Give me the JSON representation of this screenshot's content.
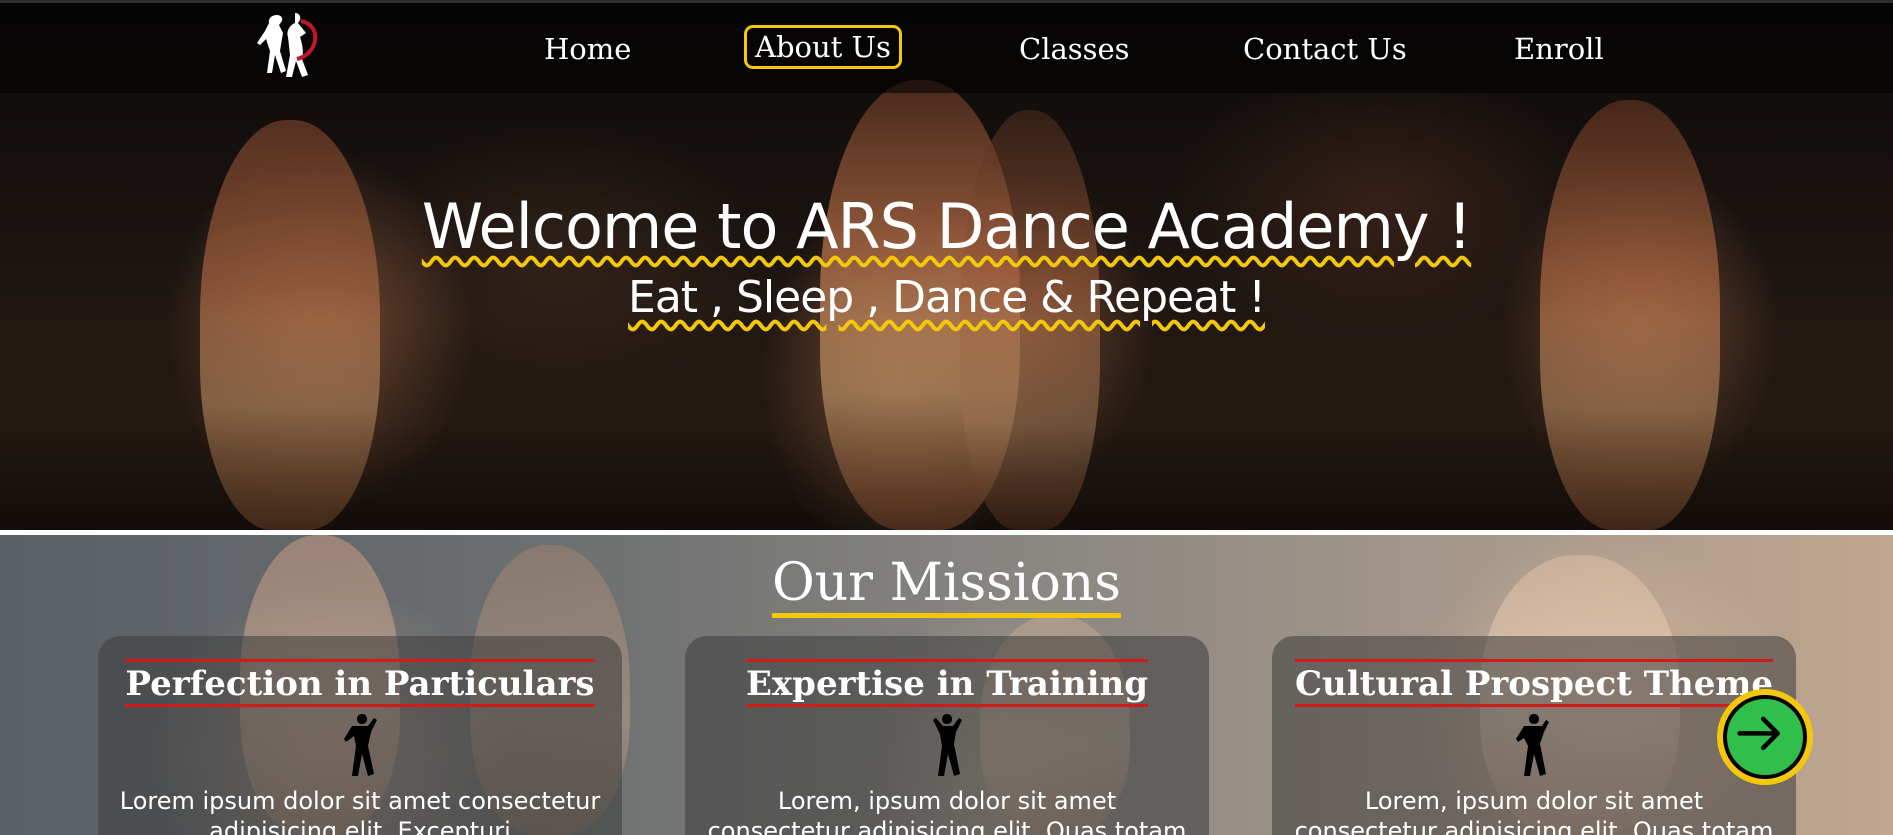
{
  "nav": {
    "logo_icon": "dancers-logo-icon",
    "items": [
      {
        "label": "Home"
      },
      {
        "label": "About Us",
        "active": true
      },
      {
        "label": "Classes"
      },
      {
        "label": "Contact Us"
      },
      {
        "label": "Enroll"
      }
    ]
  },
  "hero": {
    "title": "Welcome to ARS Dance Academy !",
    "subtitle": "Eat , Sleep , Dance & Repeat !"
  },
  "missions": {
    "title": "Our Missions",
    "cards": [
      {
        "title": "Perfection in Particulars",
        "icon": "dancer-silhouette-icon",
        "text": "Lorem ipsum dolor sit amet consectetur adipisicing elit. Excepturi"
      },
      {
        "title": "Expertise in Training",
        "icon": "dancer-silhouette-icon",
        "text": "Lorem, ipsum dolor sit amet consectetur adipisicing elit. Quas totam"
      },
      {
        "title": "Cultural Prospect Theme",
        "icon": "dancer-silhouette-icon",
        "text": "Lorem, ipsum dolor sit amet consectetur adipisicing elit. Quas totam"
      }
    ]
  },
  "next_button": {
    "icon": "arrow-right-icon"
  },
  "colors": {
    "accent_yellow": "#f3c80b",
    "underline_red": "#d21a1a",
    "button_green": "#2fbf4a"
  }
}
